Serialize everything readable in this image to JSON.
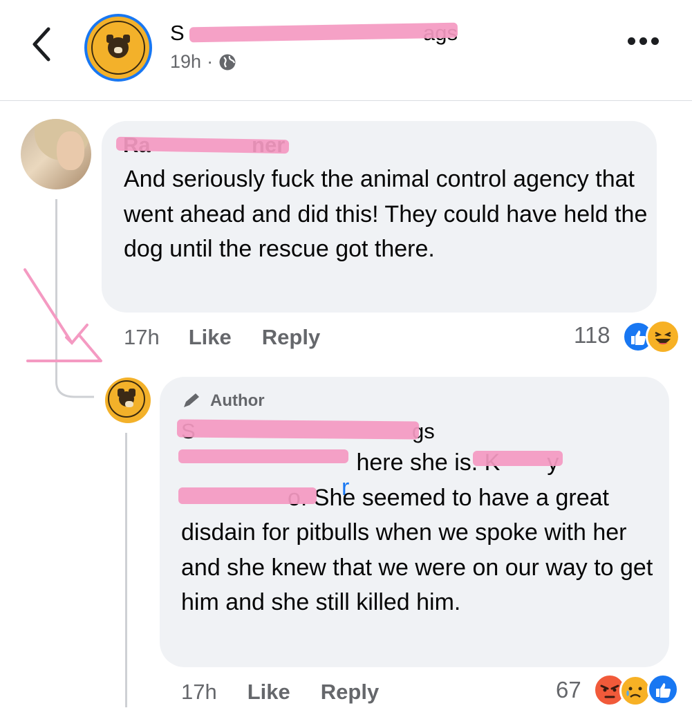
{
  "header": {
    "back_icon": "chevron-left-icon",
    "page_name_start": "S",
    "page_name_end": "ags",
    "time": "19h",
    "separator": "·",
    "audience_icon": "globe-icon",
    "more_icon": "more-horizontal-icon"
  },
  "comments": [
    {
      "author_fragment": "Ra                 ner",
      "text": "And seriously fuck the animal control agency that went ahead and did this! They could have held the dog until the rescue got there.",
      "time": "17h",
      "like_label": "Like",
      "reply_label": "Reply",
      "reaction_count": "118",
      "reactions": [
        "like",
        "haha"
      ]
    }
  ],
  "reply": {
    "badge_label": "Author",
    "badge_icon": "pencil-icon",
    "author_fragment_start": "S",
    "author_fragment_end": "gs",
    "mention_end": "r",
    "text_1": " here she is. K",
    "text_1_end": "y",
    "text_2_end": "o.",
    "text_3": " She seemed to have a great disdain for pitbulls when we spoke with her and she knew that we were on our way to get him and she still killed him.",
    "time": "17h",
    "like_label": "Like",
    "reply_label": "Reply",
    "reaction_count": "67",
    "reactions": [
      "angry",
      "sad",
      "like"
    ]
  },
  "colors": {
    "bubble": "#f0f2f5",
    "secondary_text": "#65676b",
    "link": "#1877f2",
    "redaction": "#f49ac2",
    "annotation_arrow": "#f49ac2"
  }
}
